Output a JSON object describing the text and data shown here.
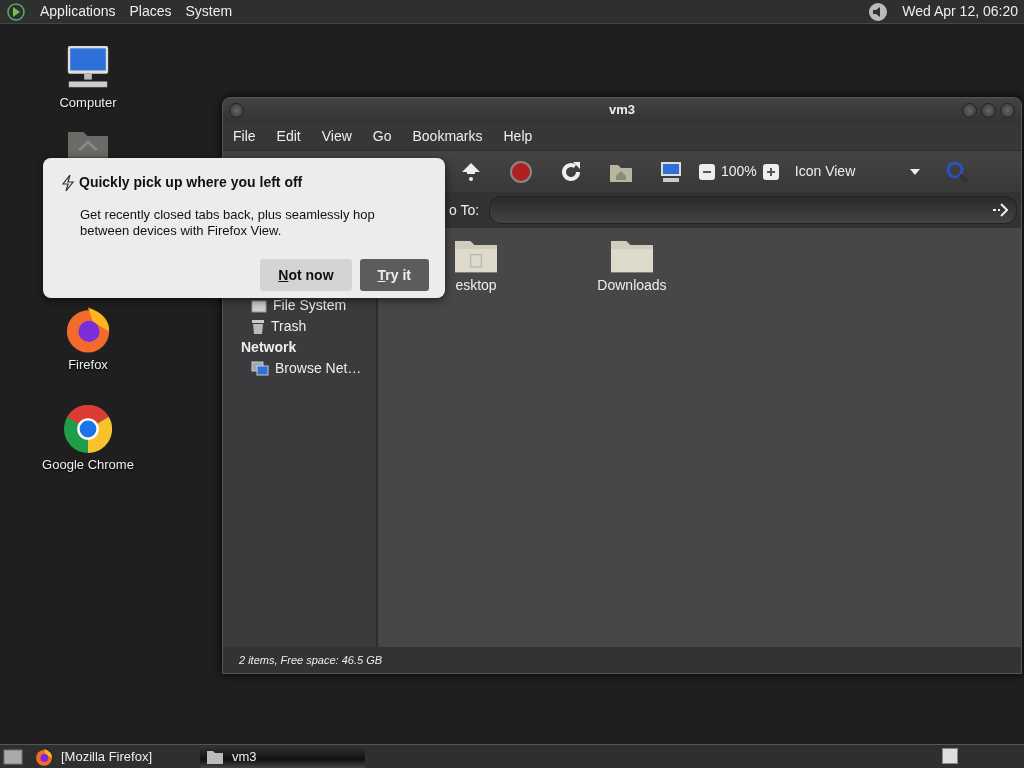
{
  "top_panel": {
    "menus": [
      "Applications",
      "Places",
      "System"
    ],
    "clock": "Wed Apr 12, 06:20"
  },
  "desktop_icons": [
    {
      "kind": "computer",
      "label": "Computer"
    },
    {
      "kind": "home"
    },
    {
      "kind": "firefox",
      "label": "Firefox"
    },
    {
      "kind": "chrome",
      "label": "Google Chrome"
    }
  ],
  "file_manager": {
    "title": "vm3",
    "menus": [
      "File",
      "Edit",
      "View",
      "Go",
      "Bookmarks",
      "Help"
    ],
    "toolbar": {
      "zoom": "100%",
      "view": "Icon View"
    },
    "location": {
      "label": "o To:"
    },
    "sidebar": [
      {
        "kind": "filesystem",
        "label": "File System"
      },
      {
        "kind": "trash",
        "label": "Trash"
      },
      {
        "kind": "heading",
        "label": "Network"
      },
      {
        "kind": "network",
        "label": "Browse Net…"
      }
    ],
    "files": [
      {
        "kind": "desktop-folder",
        "label": "esktop"
      },
      {
        "kind": "folder",
        "label": "Downloads"
      }
    ],
    "status": "2 items, Free space: 46.5 GB"
  },
  "popup": {
    "title": "Quickly pick up where you left off",
    "body": "Get recently closed tabs back, plus seamlessly hop between devices with Firefox View.",
    "buttons": [
      {
        "kind": "secondary",
        "label": "Not now"
      },
      {
        "kind": "primary",
        "label": "Try it"
      }
    ]
  },
  "taskbar": {
    "tasks": [
      {
        "kind": "firefox",
        "label": "[Mozilla Firefox]",
        "selected": false
      },
      {
        "kind": "folder",
        "label": "vm3",
        "selected": true
      }
    ]
  }
}
